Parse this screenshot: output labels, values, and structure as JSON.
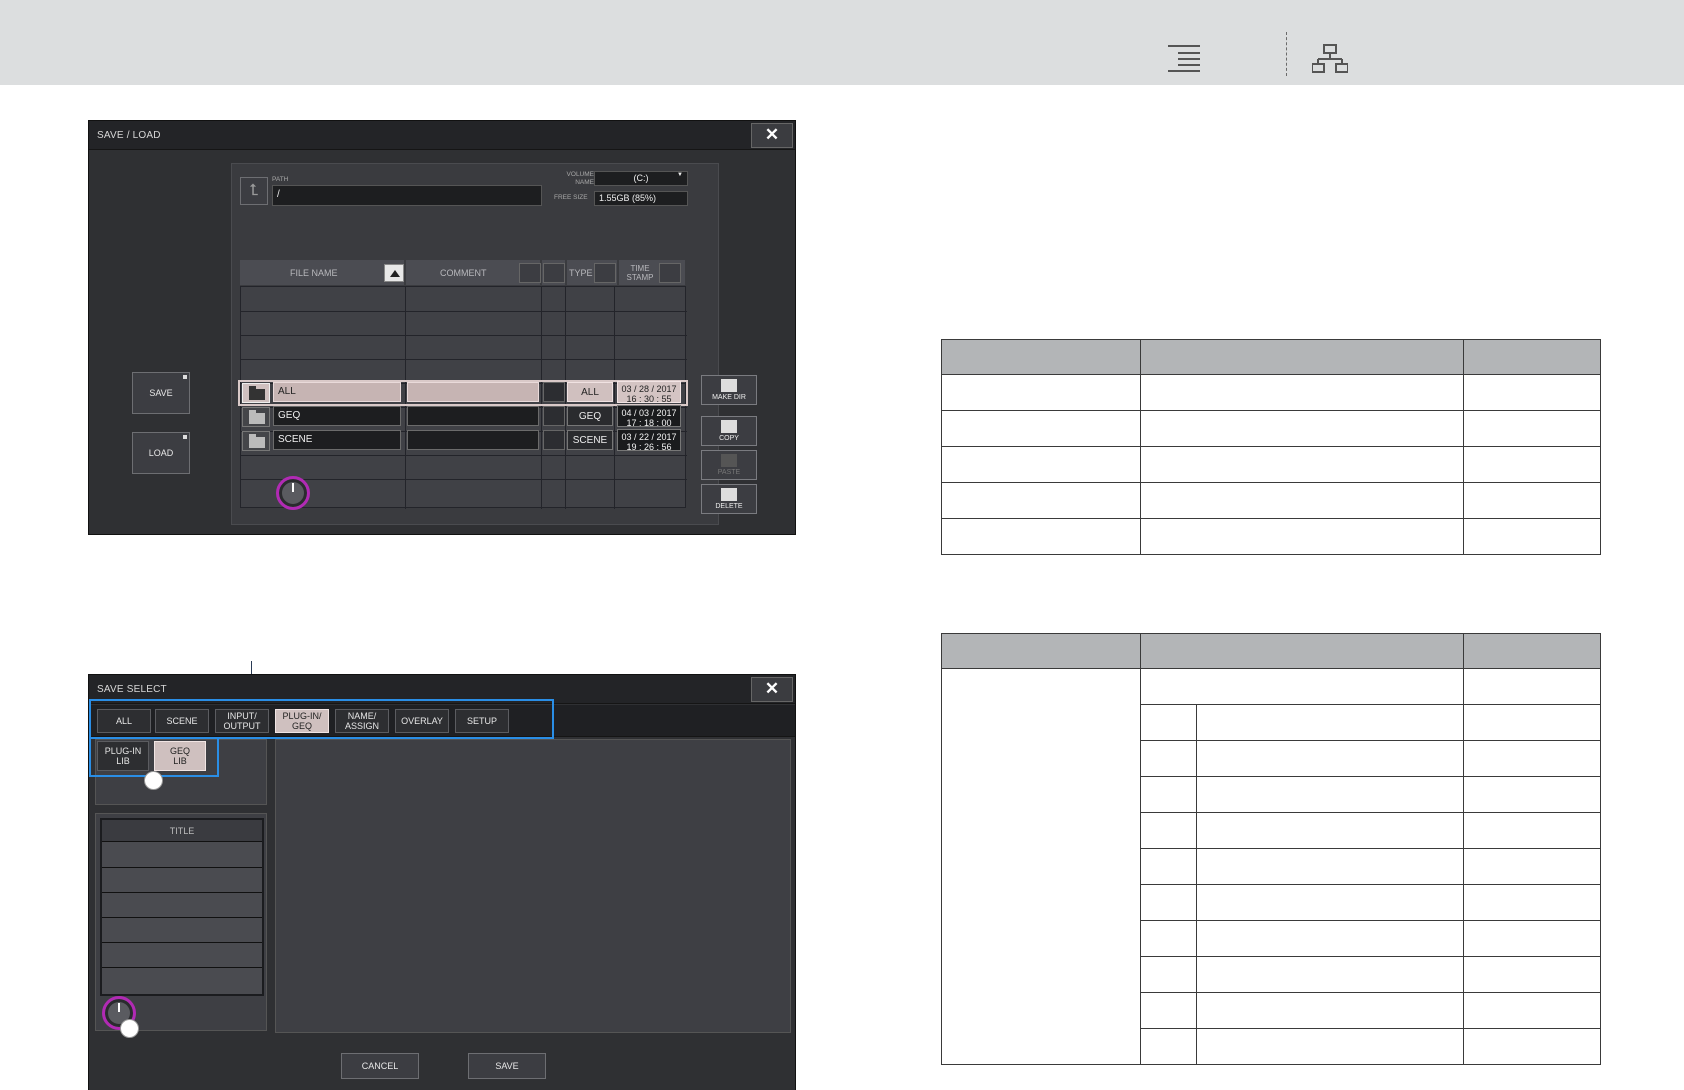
{
  "header": {
    "icons": [
      "toc-icon",
      "sitemap-icon"
    ]
  },
  "save_load": {
    "title": "SAVE / LOAD",
    "close": "✕",
    "path_label": "PATH",
    "path_value": "/",
    "volume_label": "VOLUME NAME",
    "volume_value": "(C:)",
    "free_label": "FREE SIZE",
    "free_value": "1.55GB (85%)",
    "columns": {
      "file_name": "FILE NAME",
      "comment": "COMMENT",
      "type": "TYPE",
      "time_stamp": "TIME STAMP"
    },
    "files": [
      {
        "name": "ALL",
        "type": "ALL",
        "date": "03 / 28 / 2017",
        "time": "16 : 30 : 55",
        "selected": true
      },
      {
        "name": "GEQ",
        "type": "GEQ",
        "date": "04 / 03 / 2017",
        "time": "17 : 18 : 00",
        "selected": false
      },
      {
        "name": "SCENE",
        "type": "SCENE",
        "date": "03 / 22 / 2017",
        "time": "19 : 26 : 56",
        "selected": false
      }
    ],
    "buttons": {
      "save": "SAVE",
      "load": "LOAD",
      "make_dir": "MAKE DIR",
      "copy": "COPY",
      "paste": "PASTE",
      "delete": "DELETE"
    }
  },
  "save_select": {
    "title": "SAVE SELECT",
    "close": "✕",
    "tabs": [
      "ALL",
      "SCENE",
      "INPUT/\nOUTPUT",
      "PLUG-IN/\nGEQ",
      "NAME/\nASSIGN",
      "OVERLAY",
      "SETUP"
    ],
    "selected_tab": 3,
    "subtabs": [
      "PLUG-IN\nLIB",
      "GEQ\nLIB"
    ],
    "selected_subtab": 1,
    "list_header": "TITLE",
    "cancel": "CANCEL",
    "save": "SAVE"
  },
  "colors": {
    "header_bg": "#dcdedf",
    "highlight": "#2a8ee6",
    "knob_ring": "#b12ab4",
    "table_header": "#b3b5b7"
  }
}
